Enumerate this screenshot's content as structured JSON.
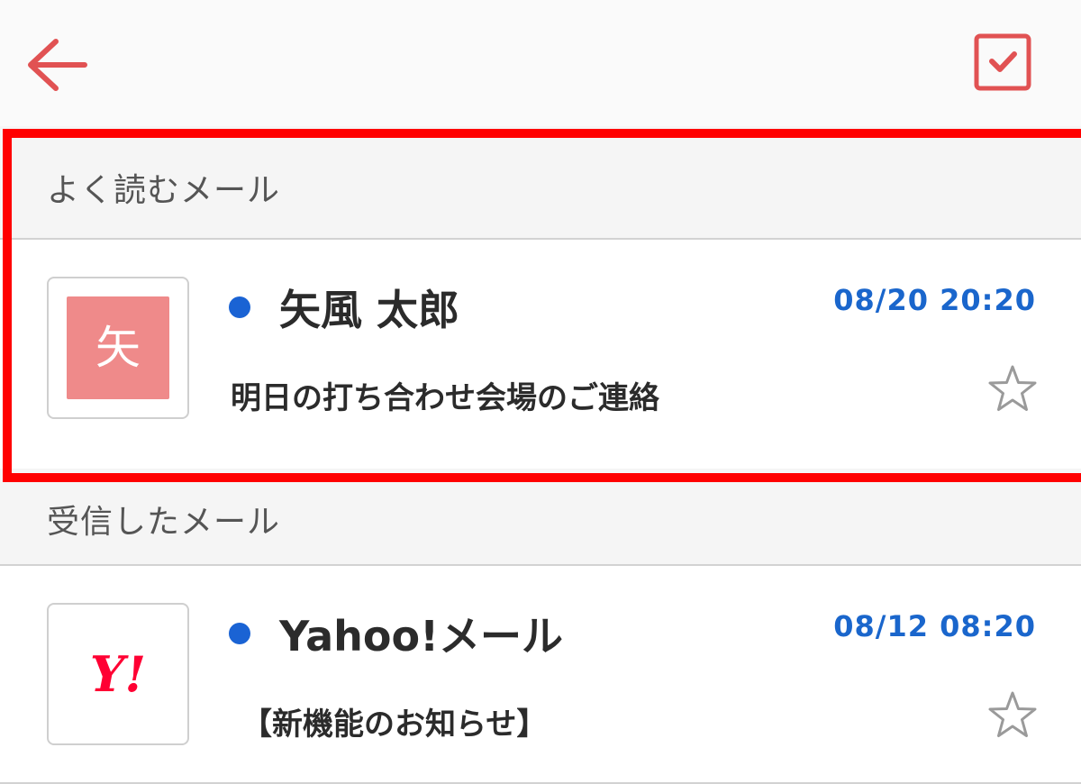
{
  "toolbar": {
    "back_icon": "arrow-left-icon",
    "select_icon": "checkbox-checked-icon",
    "accent_color": "#e15253"
  },
  "sections": {
    "frequent": {
      "label": "よく読むメール"
    },
    "received": {
      "label": "受信したメール"
    }
  },
  "mails": [
    {
      "sender": "矢風 太郎",
      "avatar_initial": "矢",
      "avatar_color": "#ef8a8a",
      "subject": "明日の打ち合わせ会場のご連絡",
      "date": "08/20 20:20",
      "unread": true,
      "starred": false
    },
    {
      "sender": "Yahoo!メール",
      "avatar_logo": "Y!",
      "avatar_logo_color": "#ff0033",
      "subject": "【新機能のお知らせ】",
      "date": "08/12 08:20",
      "unread": true,
      "starred": false
    }
  ],
  "colors": {
    "unread_dot": "#1a63d4",
    "date_text": "#1a66cc",
    "highlight": "#ff0000"
  }
}
